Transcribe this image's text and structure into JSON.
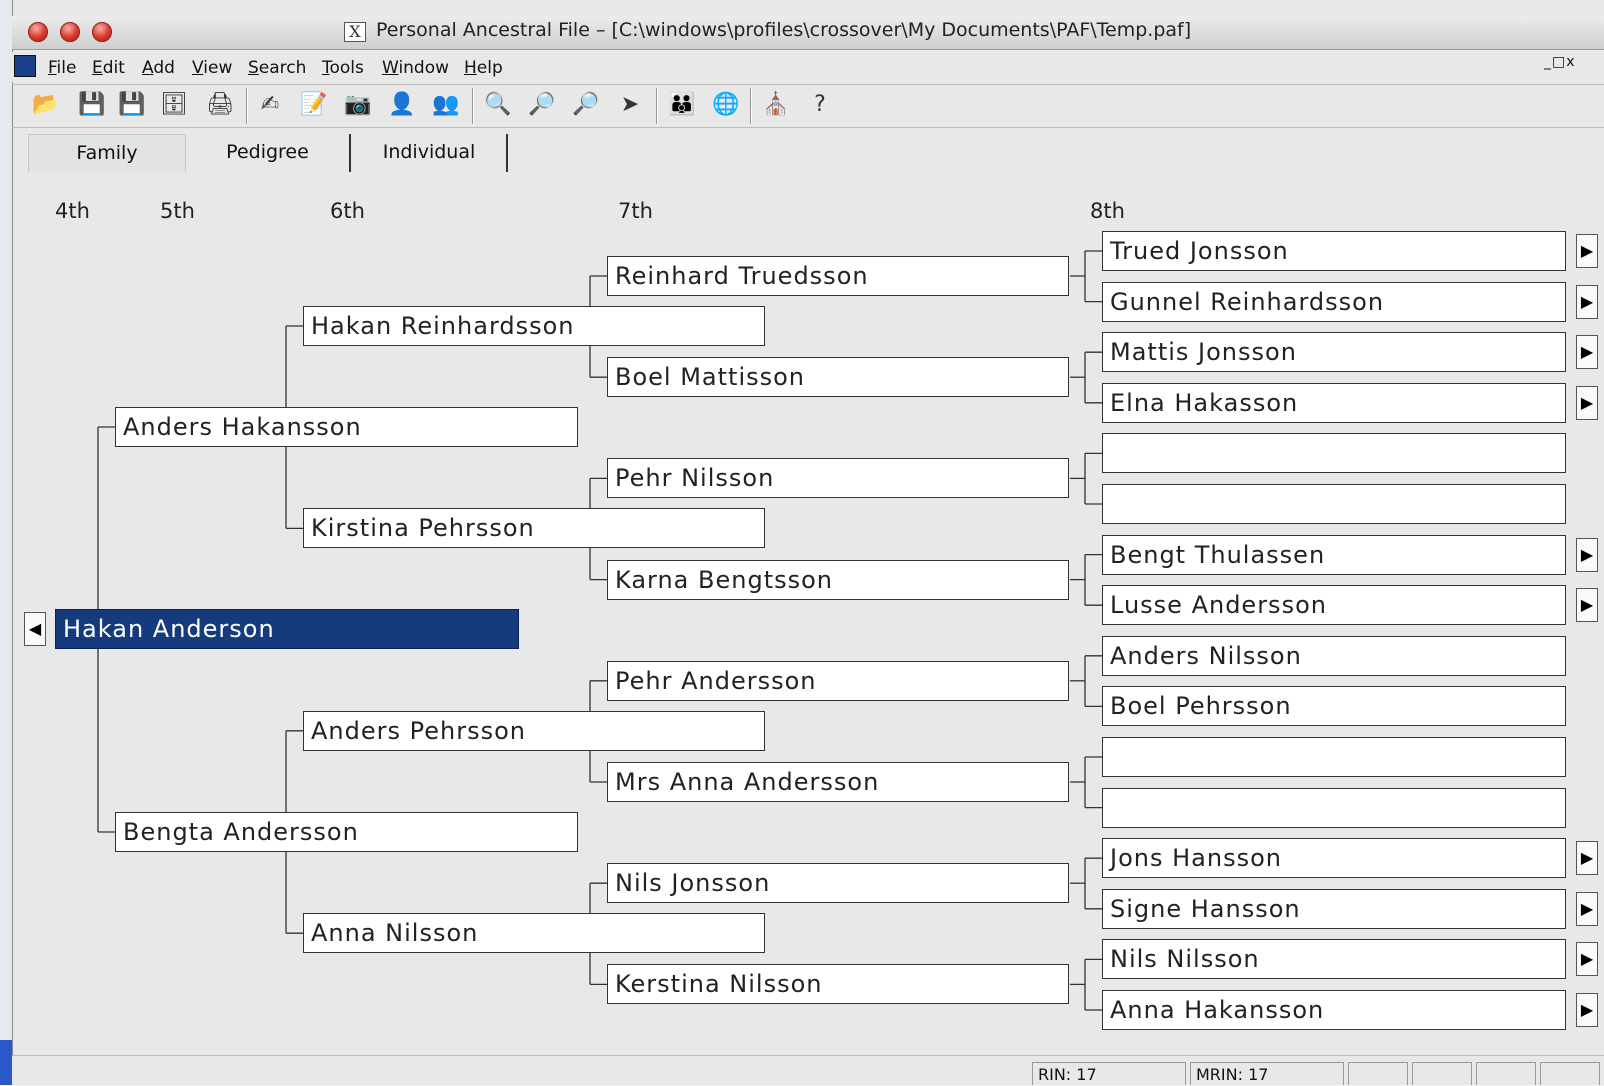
{
  "window": {
    "title": "Personal Ancestral File – [C:\\windows\\profiles\\crossover\\My Documents\\PAF\\Temp.paf]",
    "x_icon": "X",
    "mdi_controls": "_□x"
  },
  "menu": [
    {
      "pre": "",
      "ul": "F",
      "post": "ile"
    },
    {
      "pre": "",
      "ul": "E",
      "post": "dit"
    },
    {
      "pre": "",
      "ul": "A",
      "post": "dd"
    },
    {
      "pre": "",
      "ul": "V",
      "post": "iew"
    },
    {
      "pre": "",
      "ul": "S",
      "post": "earch"
    },
    {
      "pre": "",
      "ul": "T",
      "post": "ools"
    },
    {
      "pre": "",
      "ul": "W",
      "post": "indow"
    },
    {
      "pre": "",
      "ul": "H",
      "post": "elp"
    }
  ],
  "tabs": {
    "family": "Family",
    "pedigree": "Pedigree",
    "individual": "Individual"
  },
  "generations": [
    "4th",
    "5th",
    "6th",
    "7th",
    "8th"
  ],
  "people": {
    "root": "Hakan Anderson",
    "g5": [
      "Anders Hakansson",
      "Bengta Andersson"
    ],
    "g6": [
      "Hakan Reinhardsson",
      "Kirstina Pehrsson",
      "Anders Pehrsson",
      "Anna Nilsson"
    ],
    "g7": [
      "Reinhard Truedsson",
      "Boel Mattisson",
      "Pehr Nilsson",
      "Karna Bengtsson",
      "Pehr Andersson",
      "Mrs Anna Andersson",
      "Nils Jonsson",
      "Kerstina Nilsson"
    ],
    "g8": [
      "Trued Jonsson",
      "Gunnel Reinhardsson",
      "Mattis Jonsson",
      "Elna Hakasson",
      "",
      "",
      "Bengt Thulassen",
      "Lusse Andersson",
      "Anders Nilsson",
      "Boel Pehrsson",
      "",
      "",
      "Jons Hansson",
      "Signe Hansson",
      "Nils Nilsson",
      "Anna Hakansson"
    ]
  },
  "g8_has_more": [
    true,
    true,
    true,
    true,
    false,
    false,
    true,
    true,
    false,
    false,
    false,
    false,
    true,
    true,
    true,
    true
  ],
  "arrows": {
    "left": "◀",
    "right": "▶"
  },
  "status": {
    "rin": "RIN: 17",
    "mrin": "MRIN: 17"
  },
  "colors": {
    "selected": "#163b7d",
    "traffic_red": "#d9372b"
  }
}
